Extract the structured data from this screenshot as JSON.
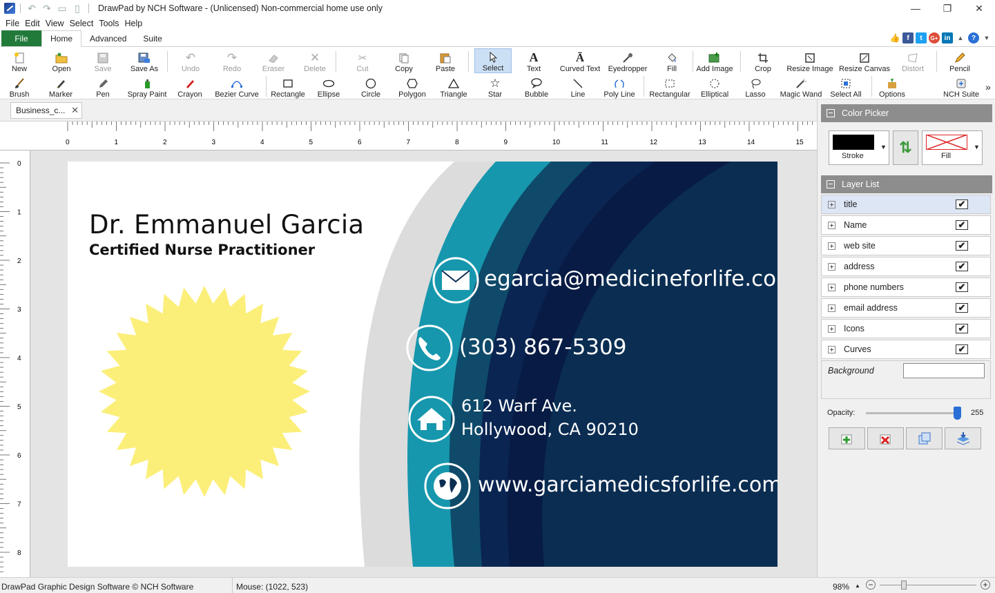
{
  "window": {
    "title": "DrawPad by NCH Software - (Unlicensed) Non-commercial home use only",
    "minimize": "—",
    "maximize": "❐",
    "close": "✕"
  },
  "menu": [
    "File",
    "Edit",
    "View",
    "Select",
    "Tools",
    "Help"
  ],
  "ribbon_tabs": {
    "file": "File",
    "home": "Home",
    "advanced": "Advanced",
    "suite": "Suite"
  },
  "social": {
    "thumbs": "👍",
    "facebook": "f",
    "twitter": "t",
    "google": "G+",
    "linkedin": "in",
    "help": "?"
  },
  "toolbar_row1": [
    {
      "label": "New",
      "icon": "new-icon",
      "state": "enabled"
    },
    {
      "label": "Open",
      "icon": "open-icon",
      "state": "enabled"
    },
    {
      "label": "Save",
      "icon": "save-icon",
      "state": "disabled"
    },
    {
      "label": "Save As",
      "icon": "save-as-icon",
      "state": "enabled"
    },
    {
      "label": "Undo",
      "icon": "undo-icon",
      "state": "disabled"
    },
    {
      "label": "Redo",
      "icon": "redo-icon",
      "state": "disabled"
    },
    {
      "label": "Eraser",
      "icon": "eraser-icon",
      "state": "disabled"
    },
    {
      "label": "Delete",
      "icon": "delete-icon",
      "state": "disabled"
    },
    {
      "label": "Cut",
      "icon": "cut-icon",
      "state": "disabled"
    },
    {
      "label": "Copy",
      "icon": "copy-icon",
      "state": "enabled"
    },
    {
      "label": "Paste",
      "icon": "paste-icon",
      "state": "enabled"
    },
    {
      "label": "Select",
      "icon": "select-icon",
      "state": "selected"
    },
    {
      "label": "Text",
      "icon": "text-icon",
      "state": "enabled"
    },
    {
      "label": "Curved Text",
      "icon": "curved-text-icon",
      "state": "enabled"
    },
    {
      "label": "Eyedropper",
      "icon": "eyedropper-icon",
      "state": "enabled"
    },
    {
      "label": "Fill",
      "icon": "fill-icon",
      "state": "enabled"
    },
    {
      "label": "Add Image",
      "icon": "add-image-icon",
      "state": "enabled"
    },
    {
      "label": "Crop",
      "icon": "crop-icon",
      "state": "enabled"
    },
    {
      "label": "Resize Image",
      "icon": "resize-image-icon",
      "state": "enabled"
    },
    {
      "label": "Resize Canvas",
      "icon": "resize-canvas-icon",
      "state": "enabled"
    },
    {
      "label": "Distort",
      "icon": "distort-icon",
      "state": "disabled"
    },
    {
      "label": "Pencil",
      "icon": "pencil-icon",
      "state": "enabled"
    }
  ],
  "toolbar_row2": [
    {
      "label": "Brush",
      "icon": "brush-icon"
    },
    {
      "label": "Marker",
      "icon": "marker-icon"
    },
    {
      "label": "Pen",
      "icon": "pen-icon"
    },
    {
      "label": "Spray Paint",
      "icon": "spray-paint-icon"
    },
    {
      "label": "Crayon",
      "icon": "crayon-icon"
    },
    {
      "label": "Bezier Curve",
      "icon": "bezier-curve-icon"
    },
    {
      "label": "Rectangle",
      "icon": "rectangle-icon"
    },
    {
      "label": "Ellipse",
      "icon": "ellipse-icon"
    },
    {
      "label": "Circle",
      "icon": "circle-icon"
    },
    {
      "label": "Polygon",
      "icon": "polygon-icon"
    },
    {
      "label": "Triangle",
      "icon": "triangle-icon"
    },
    {
      "label": "Star",
      "icon": "star-icon"
    },
    {
      "label": "Bubble",
      "icon": "bubble-icon"
    },
    {
      "label": "Line",
      "icon": "line-icon"
    },
    {
      "label": "Poly Line",
      "icon": "poly-line-icon"
    },
    {
      "label": "Rectangular",
      "icon": "rectangular-select-icon"
    },
    {
      "label": "Elliptical",
      "icon": "elliptical-select-icon"
    },
    {
      "label": "Lasso",
      "icon": "lasso-icon"
    },
    {
      "label": "Magic Wand",
      "icon": "magic-wand-icon"
    },
    {
      "label": "Select All",
      "icon": "select-all-icon"
    },
    {
      "label": "Options",
      "icon": "options-icon"
    },
    {
      "label": "NCH Suite",
      "icon": "nch-suite-icon"
    }
  ],
  "overflow_arrow": "»",
  "document_tab": {
    "label": "Business_c...",
    "close": "✕"
  },
  "ruler": {
    "h_numbers": [
      "0",
      "1",
      "2",
      "3",
      "4",
      "5",
      "6",
      "7",
      "8",
      "9",
      "10",
      "11",
      "12",
      "13",
      "14",
      "15"
    ],
    "v_numbers": [
      "0",
      "1",
      "2",
      "3",
      "4",
      "5",
      "6",
      "7",
      "8"
    ]
  },
  "card": {
    "name": "Dr. Emmanuel Garcia",
    "title": "Certified Nurse Practitioner",
    "email": "egarcia@medicineforlife.com",
    "phone": "(303) 867-5309",
    "address_line1": "612 Warf Ave.",
    "address_line2": "Hollywood, CA 90210",
    "website": "www.garciamedicsforlife.com"
  },
  "colors": {
    "ribbon_file": "#217a3a",
    "panel_header": "#8d8d8d",
    "card_navy": "#0b2d52",
    "card_teal": "#1797ad",
    "card_dark": "#061c45",
    "card_gray": "#dcdcdc",
    "starburst": "#fbef7a"
  },
  "color_picker": {
    "header": "Color Picker",
    "stroke_label": "Stroke",
    "fill_label": "Fill",
    "swap": "⇅",
    "dropdown": "▼"
  },
  "layer_list": {
    "header": "Layer List",
    "layers": [
      {
        "name": "title",
        "visible": true
      },
      {
        "name": "Name",
        "visible": true
      },
      {
        "name": "web site",
        "visible": true
      },
      {
        "name": "address",
        "visible": true
      },
      {
        "name": "phone numbers",
        "visible": true
      },
      {
        "name": "email address",
        "visible": true
      },
      {
        "name": "Icons",
        "visible": true
      },
      {
        "name": "Curves",
        "visible": true
      }
    ],
    "check_mark": "✔",
    "background_label": "Background"
  },
  "opacity": {
    "label": "Opacity:",
    "value": "255",
    "fraction": 1.0
  },
  "status": {
    "left": "DrawPad Graphic Design Software © NCH Software",
    "mouse": "Mouse: (1022, 523)",
    "zoom": "98%",
    "zoom_arrow": "▲",
    "zoom_minus": "−",
    "zoom_plus": "+"
  }
}
